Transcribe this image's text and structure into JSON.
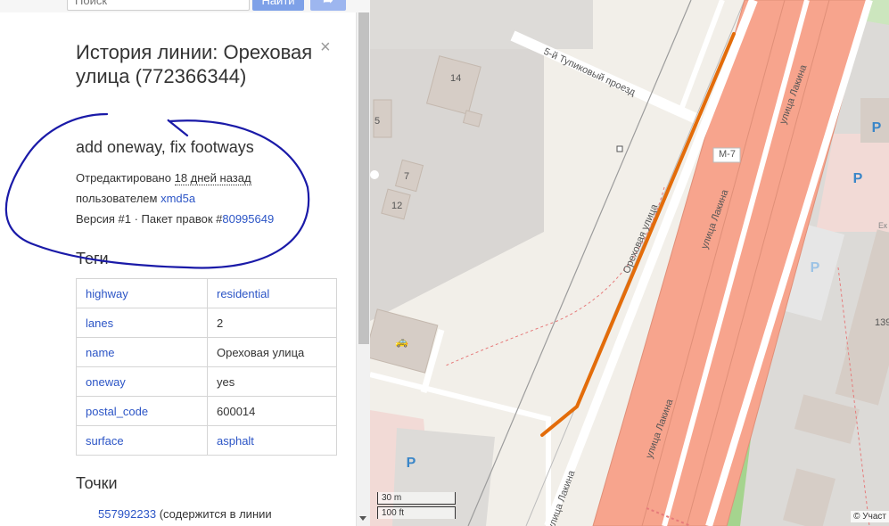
{
  "search": {
    "placeholder": "Поиск",
    "button_label": "Найти"
  },
  "panel": {
    "title": "История линии: Ореховая улица (772366344)",
    "close_glyph": "×",
    "comment": "add oneway, fix footways",
    "edited_prefix": "Отредактировано",
    "edited_time": "18 дней назад",
    "by_prefix": "пользователем",
    "user": "xmd5a",
    "version_prefix": "Версия #1 · Пакет правок #",
    "changeset": "80995649",
    "tags_title": "Теги",
    "tags": [
      {
        "key": "highway",
        "value": "residential"
      },
      {
        "key": "lanes",
        "value": "2"
      },
      {
        "key": "name",
        "value": "Ореховая улица"
      },
      {
        "key": "oneway",
        "value": "yes"
      },
      {
        "key": "postal_code",
        "value": "600014"
      },
      {
        "key": "surface",
        "value": "asphalt"
      }
    ],
    "nodes_title": "Точки",
    "node_id": "557992233",
    "node_suffix": " (содержится в линии"
  },
  "map": {
    "labels": {
      "proezd": "5-й Тупиковый проезд",
      "orekhovaya": "Ореховая улица",
      "lakina1": "улица Лакина",
      "lakina2": "улица Лакина",
      "lakina3": "улица Лакина",
      "lakina4": "улица Лакина",
      "route": "М-7",
      "house14": "14",
      "house5": "5",
      "house7": "7",
      "house12": "12",
      "house139": "139",
      "shop_cut": "Ек"
    },
    "parking_glyph": "P",
    "scale_m": "30 m",
    "scale_ft": "100 ft",
    "attribution": "© Участ",
    "colors": {
      "highlight": "#e36c0a",
      "trunk": "#f7a48d",
      "accent": "#7ea1e8"
    }
  },
  "annotation": {
    "color": "#1a1aa8"
  }
}
